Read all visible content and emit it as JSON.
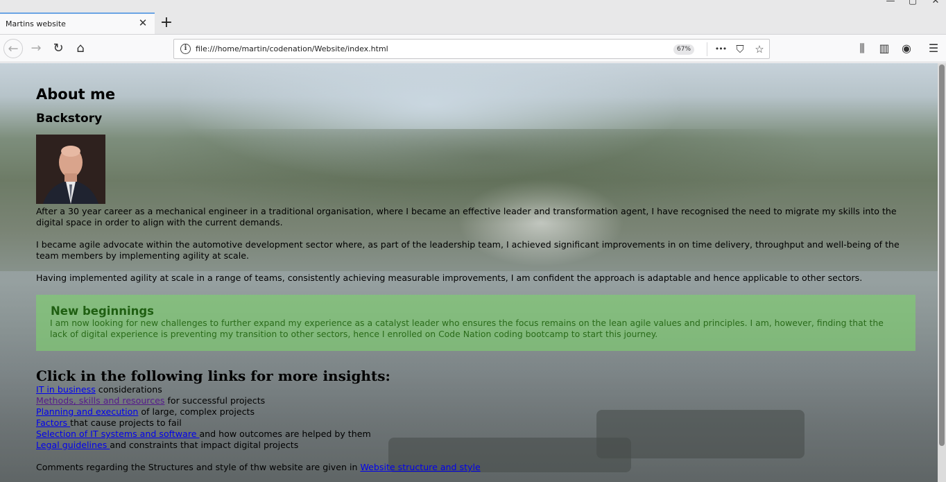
{
  "window": {
    "minimize_icon": "minimize-icon",
    "maximize_icon": "maximize-icon",
    "close_icon": "close-icon"
  },
  "tab": {
    "title": "Martins website",
    "close_glyph": "✕"
  },
  "newtab_glyph": "+",
  "nav": {
    "back_glyph": "←",
    "forward_glyph": "→",
    "reload_glyph": "↻",
    "home_glyph": "⌂",
    "url": "file:///home/martin/codenation/Website/index.html",
    "zoom": "67%",
    "more_glyph": "•••",
    "pocket_glyph": "⛉",
    "bookmark_glyph": "☆",
    "library_glyph": "⫼",
    "sidebar_glyph": "▥",
    "account_glyph": "◉",
    "menu_glyph": "☰"
  },
  "page": {
    "heading": "About me",
    "subheading": "Backstory",
    "paragraphs": [
      "After a 30 year career as a mechanical engineer in a traditional organisation, where I became an effective leader and transformation agent, I have recognised the need to migrate my skills into the digital space in order to align with the current demands.",
      "I became agile advocate within the automotive development sector where, as part of the leadership team, I achieved significant improvements in on time delivery, throughput and well-being of the team members by implementing agility at scale.",
      "Having implemented agility at scale in a range of teams, consistently achieving measurable improvements, I am confident the approach is adaptable and hence applicable to other sectors."
    ],
    "callout": {
      "title": "New beginnings",
      "text": "I am now looking for new challenges to further expand my experience as a catalyst leader who ensures the focus remains on the lean agile values and principles. I am, however, finding that the lack of digital experience is preventing my transition to other sectors, hence I enrolled on Code Nation coding bootcamp to start this journey."
    },
    "links_heading": "Click in the following links for more insights:",
    "links": [
      {
        "link": "IT in business",
        "rest": " considerations"
      },
      {
        "link": "Methods, skills and resources",
        "rest": " for successful projects"
      },
      {
        "link": "Planning and execution",
        "rest": " of large, complex projects"
      },
      {
        "link": "Factors ",
        "rest": "that cause projects to fail"
      },
      {
        "link": "Selection of IT systems and software ",
        "rest": "and how outcomes are helped by them"
      },
      {
        "link": "Legal guidelines ",
        "rest": "and constraints that impact digital projects"
      }
    ],
    "footer_text": "Comments regarding the Structures and style of thw website are given in ",
    "footer_link": "Website structure and style"
  }
}
